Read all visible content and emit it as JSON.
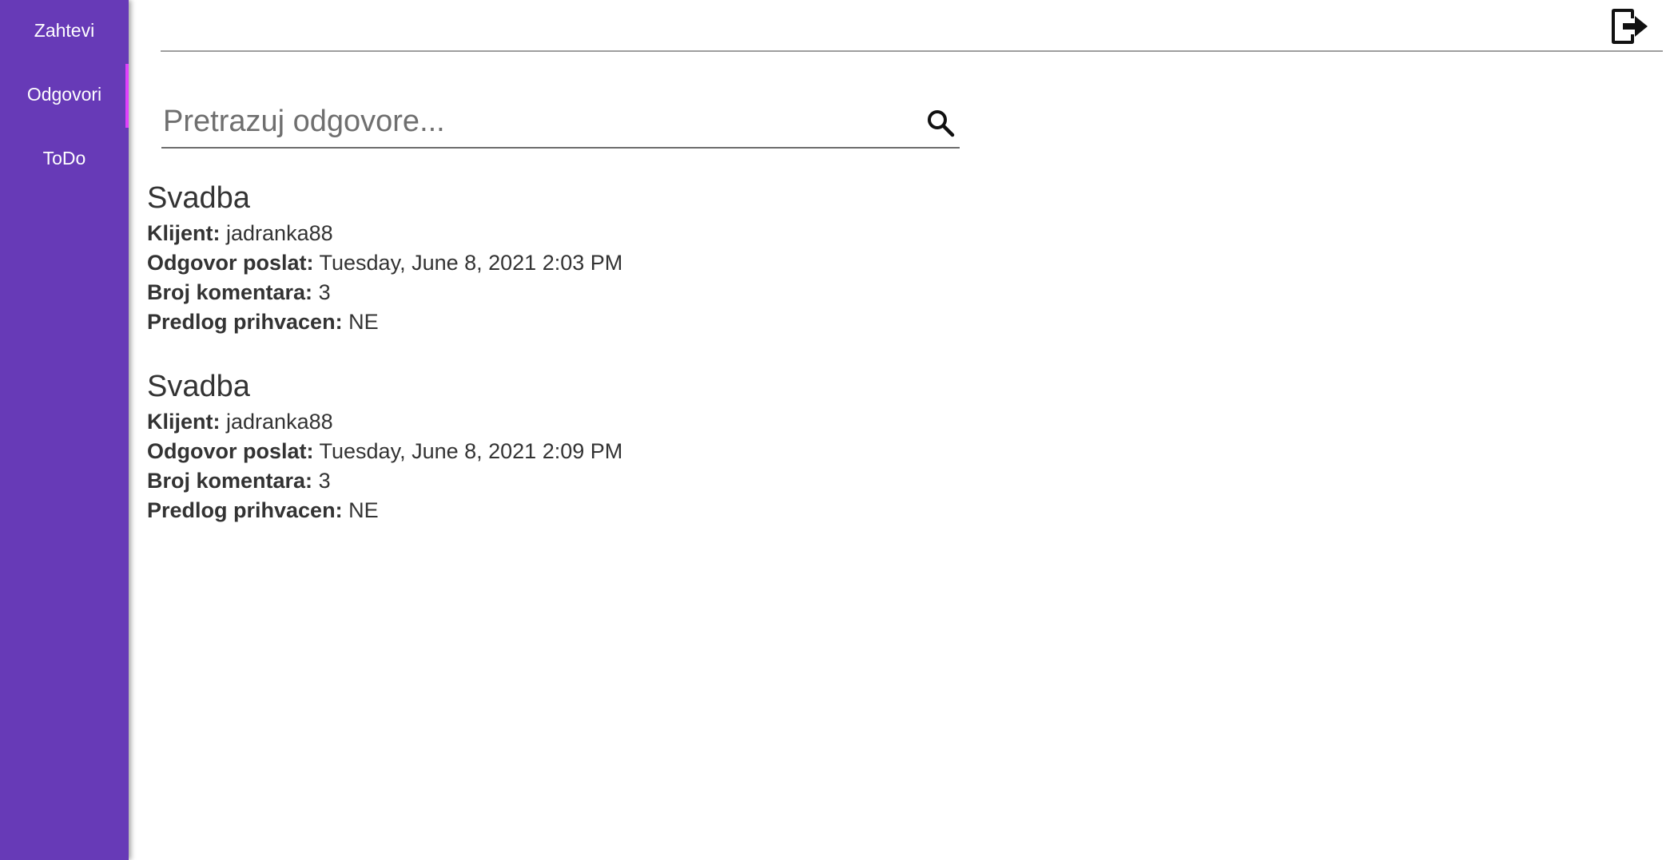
{
  "sidebar": {
    "items": [
      {
        "label": "Zahtevi",
        "active": false
      },
      {
        "label": "Odgovori",
        "active": true
      },
      {
        "label": "ToDo",
        "active": false
      }
    ]
  },
  "header": {
    "logout_icon": "logout-icon"
  },
  "search": {
    "placeholder": "Pretrazuj odgovore...",
    "value": "",
    "icon": "search-icon"
  },
  "labels": {
    "client": "Klijent:",
    "sent": "Odgovor poslat:",
    "comments": "Broj komentara:",
    "accepted": "Predlog prihvacen:"
  },
  "responses": [
    {
      "title": "Svadba",
      "client": "jadranka88",
      "sent": "Tuesday, June 8, 2021 2:03 PM",
      "comments": "3",
      "accepted": "NE"
    },
    {
      "title": "Svadba",
      "client": "jadranka88",
      "sent": "Tuesday, June 8, 2021 2:09 PM",
      "comments": "3",
      "accepted": "NE"
    }
  ],
  "colors": {
    "sidebar": "#673ab7",
    "active_indicator": "#e040fb",
    "text": "#333333"
  }
}
